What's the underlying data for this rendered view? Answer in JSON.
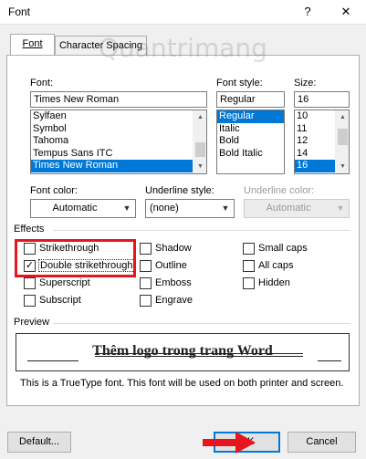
{
  "window": {
    "title": "Font",
    "help_glyph": "?",
    "close_glyph": "✕"
  },
  "tabs": [
    {
      "label": "Font"
    },
    {
      "label": "Character Spacing"
    }
  ],
  "watermark": {
    "text": "Quantrimang"
  },
  "font": {
    "label": "Font:",
    "value": "Times New Roman",
    "items": [
      "Sylfaen",
      "Symbol",
      "Tahoma",
      "Tempus Sans ITC",
      "Times New Roman"
    ]
  },
  "font_style": {
    "label": "Font style:",
    "value": "Regular",
    "items": [
      "Regular",
      "Italic",
      "Bold",
      "Bold Italic"
    ]
  },
  "size": {
    "label": "Size:",
    "value": "16",
    "items": [
      "10",
      "11",
      "12",
      "14",
      "16"
    ]
  },
  "font_color": {
    "label": "Font color:",
    "value": "Automatic"
  },
  "underline_style": {
    "label": "Underline style:",
    "value": "(none)"
  },
  "underline_color": {
    "label": "Underline color:",
    "value": "Automatic"
  },
  "effects": {
    "label": "Effects",
    "items": [
      {
        "label": "Strikethrough",
        "checked": false
      },
      {
        "label": "Double strikethrough",
        "checked": true
      },
      {
        "label": "Superscript",
        "checked": false
      },
      {
        "label": "Subscript",
        "checked": false
      },
      {
        "label": "Shadow",
        "checked": false
      },
      {
        "label": "Outline",
        "checked": false
      },
      {
        "label": "Emboss",
        "checked": false
      },
      {
        "label": "Engrave",
        "checked": false
      },
      {
        "label": "Small caps",
        "checked": false
      },
      {
        "label": "All caps",
        "checked": false
      },
      {
        "label": "Hidden",
        "checked": false
      }
    ]
  },
  "preview": {
    "label": "Preview",
    "sample": "Thêm logo trong trang Word",
    "info": "This is a TrueType font. This font will be used on both printer and screen."
  },
  "buttons": {
    "default": "Default...",
    "ok": "OK",
    "cancel": "Cancel"
  },
  "colors": {
    "selection": "#0078d7",
    "highlight": "#e8141e"
  }
}
